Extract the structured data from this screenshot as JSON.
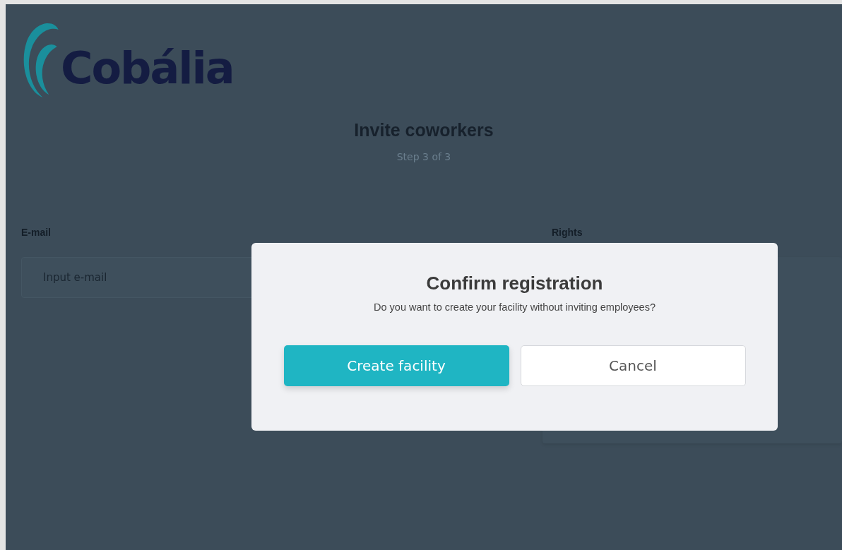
{
  "logo": {
    "text": "Cobália"
  },
  "header": {
    "title": "Invite coworkers",
    "step": "Step 3 of 3"
  },
  "form": {
    "email_label": "E-mail",
    "email_placeholder": "Input e-mail",
    "rights_label": "Rights"
  },
  "dialog": {
    "title": "Confirm registration",
    "message": "Do you want to create your facility without inviting employees?",
    "buttons": [
      {
        "label": "Create facility",
        "kind": "primary"
      },
      {
        "label": "Cancel",
        "kind": "secondary"
      }
    ]
  }
}
